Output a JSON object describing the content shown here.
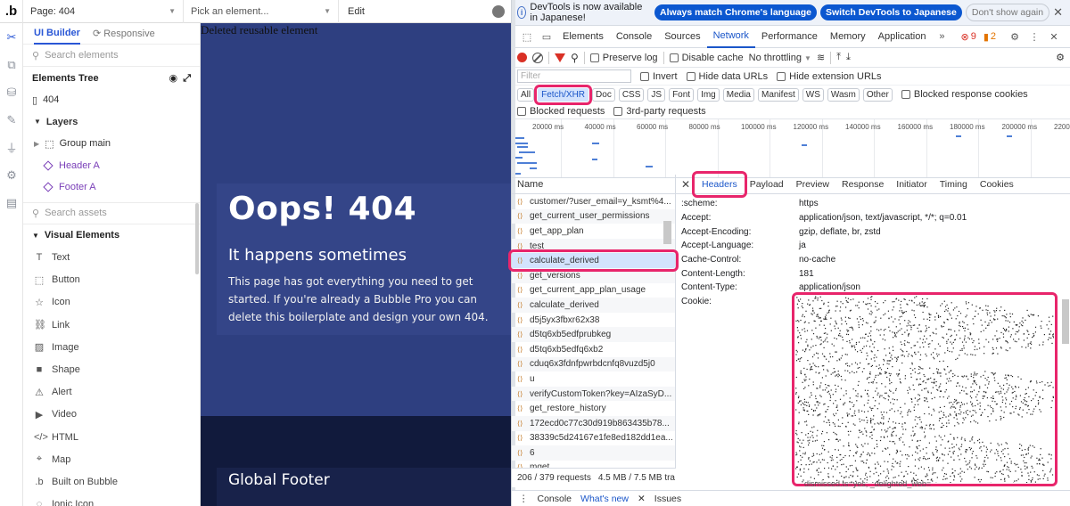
{
  "bubble": {
    "logo": ".b",
    "page_selector": "Page: 404",
    "element_selector_placeholder": "Pick an element...",
    "edit_tab": "Edit",
    "panel_tabs": [
      "UI Builder",
      "Responsive"
    ],
    "search_elements_placeholder": "Search elements",
    "elements_tree_title": "Elements Tree",
    "tree": {
      "page": "404",
      "layers": "Layers",
      "group_main": "Group main",
      "header": "Header A",
      "footer": "Footer A"
    },
    "search_assets_placeholder": "Search assets",
    "visual_elements_title": "Visual Elements",
    "visual_elements": [
      {
        "icon": "T",
        "label": "Text"
      },
      {
        "icon": "⬚",
        "label": "Button"
      },
      {
        "icon": "☆",
        "label": "Icon"
      },
      {
        "icon": "⛓",
        "label": "Link"
      },
      {
        "icon": "▨",
        "label": "Image"
      },
      {
        "icon": "■",
        "label": "Shape"
      },
      {
        "icon": "⚠",
        "label": "Alert"
      },
      {
        "icon": "▶",
        "label": "Video"
      },
      {
        "icon": "</>",
        "label": "HTML"
      },
      {
        "icon": "⌖",
        "label": "Map"
      },
      {
        "icon": ".b",
        "label": "Built on Bubble"
      },
      {
        "icon": "◌",
        "label": "Ionic Icon"
      }
    ],
    "canvas": {
      "deleted_notice": "Deleted reusable element",
      "heading": "Oops! 404",
      "subheading": "It happens sometimes",
      "body": "This page has got everything you need to get started. If you're already a Bubble Pro you can delete this boilerplate and design your own 404.",
      "footer_title": "Global Footer"
    }
  },
  "devtools": {
    "infobar": {
      "text": "DevTools is now available in Japanese!",
      "btn_match": "Always match Chrome's language",
      "btn_switch": "Switch DevTools to Japanese",
      "btn_dismiss": "Don't show again"
    },
    "tabs": [
      "Elements",
      "Console",
      "Sources",
      "Network",
      "Performance",
      "Memory",
      "Application"
    ],
    "active_tab": "Network",
    "errors": "9",
    "warnings": "2",
    "toolbar": {
      "preserve_log": "Preserve log",
      "disable_cache": "Disable cache",
      "throttling": "No throttling"
    },
    "filter": {
      "placeholder": "Filter",
      "invert": "Invert",
      "hide_data_urls": "Hide data URLs",
      "hide_extension_urls": "Hide extension URLs"
    },
    "types": [
      "All",
      "Fetch/XHR",
      "Doc",
      "CSS",
      "JS",
      "Font",
      "Img",
      "Media",
      "Manifest",
      "WS",
      "Wasm",
      "Other"
    ],
    "blocked_response_cookies": "Blocked response cookies",
    "blocked_requests": "Blocked requests",
    "third_party": "3rd-party requests",
    "timeline_labels": [
      "20000 ms",
      "40000 ms",
      "60000 ms",
      "80000 ms",
      "100000 ms",
      "120000 ms",
      "140000 ms",
      "160000 ms",
      "180000 ms",
      "200000 ms",
      "2200"
    ],
    "name_header": "Name",
    "requests": [
      "customer/?user_email=y_ksmt%4...",
      "get_current_user_permissions",
      "get_app_plan",
      "test",
      "calculate_derived",
      "get_versions",
      "get_current_app_plan_usage",
      "calculate_derived",
      "d5j5yx3fbxr62x38",
      "d5tq6xb5edfprubkeg",
      "d5tq6xb5edfq6xb2",
      "cduq6x3fdnfpwrbdcnfq8vuzd5j0",
      "u",
      "verifyCustomToken?key=AIzaSyD...",
      "get_restore_history",
      "172ecd0c77c30d919b863435b78...",
      "38339c5d24167e1fe8ed182dd1ea...",
      "6",
      "mget"
    ],
    "selected_request_index": 4,
    "status": {
      "count": "206 / 379 requests",
      "size": "4.5 MB / 7.5 MB tra"
    },
    "detail_tabs": [
      "Headers",
      "Payload",
      "Preview",
      "Response",
      "Initiator",
      "Timing",
      "Cookies"
    ],
    "headers": [
      {
        "k": ":scheme:",
        "v": "https"
      },
      {
        "k": "Accept:",
        "v": "application/json, text/javascript, */*; q=0.01"
      },
      {
        "k": "Accept-Encoding:",
        "v": "gzip, deflate, br, zstd"
      },
      {
        "k": "Accept-Language:",
        "v": "ja"
      },
      {
        "k": "Cache-Control:",
        "v": "no-cache"
      },
      {
        "k": "Content-Length:",
        "v": "181"
      },
      {
        "k": "Content-Type:",
        "v": "application/json"
      },
      {
        "k": "Cookie:",
        "v": ""
      }
    ],
    "cookie_tail": "dismissed.ts=yes; _delighted_web=",
    "drawer": {
      "console": "Console",
      "whats_new": "What's new",
      "issues": "Issues"
    },
    "colors": {
      "highlight": "#e8256b",
      "accent": "#1a56c9",
      "error": "#d93025",
      "warning": "#e37400"
    }
  }
}
